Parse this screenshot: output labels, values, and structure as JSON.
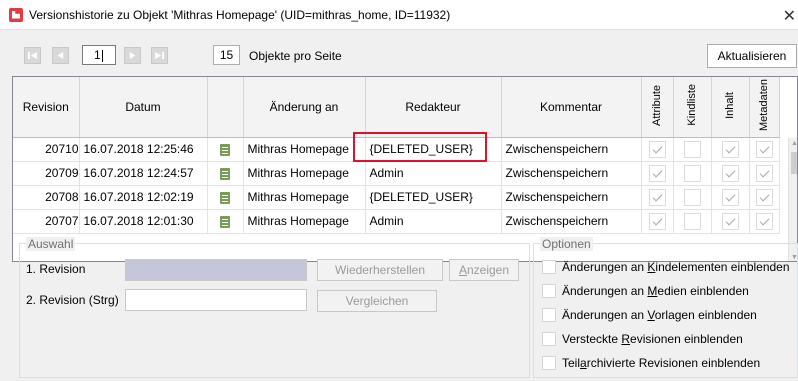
{
  "window": {
    "title": "Versionshistorie zu Objekt 'Mithras Homepage' (UID=mithras_home, ID=11932)",
    "close_glyph": "✕"
  },
  "toolbar": {
    "page_value": "1",
    "per_page_value": "15",
    "per_page_label": "Objekte pro Seite",
    "refresh_label": "Aktualisieren"
  },
  "table": {
    "headers": {
      "revision": "Revision",
      "datum": "Datum",
      "aenderung": "Änderung an",
      "redakteur": "Redakteur",
      "kommentar": "Kommentar",
      "attribute": "Attribute",
      "kindliste": "Kindliste",
      "inhalt": "Inhalt",
      "metadaten": "Metadaten"
    },
    "rows": [
      {
        "revision": "20710",
        "datum": "16.07.2018 12:25:46",
        "aenderung": "Mithras Homepage",
        "redakteur": "{DELETED_USER}",
        "kommentar": "Zwischenspeichern",
        "attribute": true,
        "kindliste": false,
        "inhalt": true,
        "metadaten": true
      },
      {
        "revision": "20709",
        "datum": "16.07.2018 12:24:57",
        "aenderung": "Mithras Homepage",
        "redakteur": "Admin",
        "kommentar": "Zwischenspeichern",
        "attribute": true,
        "kindliste": false,
        "inhalt": true,
        "metadaten": true
      },
      {
        "revision": "20708",
        "datum": "16.07.2018 12:02:19",
        "aenderung": "Mithras Homepage",
        "redakteur": "{DELETED_USER}",
        "kommentar": "Zwischenspeichern",
        "attribute": true,
        "kindliste": false,
        "inhalt": true,
        "metadaten": true
      },
      {
        "revision": "20707",
        "datum": "16.07.2018 12:01:30",
        "aenderung": "Mithras Homepage",
        "redakteur": "Admin",
        "kommentar": "Zwischenspeichern",
        "attribute": true,
        "kindliste": false,
        "inhalt": true,
        "metadaten": true
      }
    ]
  },
  "auswahl": {
    "legend": "Auswahl",
    "rev1_label": "1. Revision",
    "rev2_label": "2. Revision (Strg)",
    "restore_label": "Wiederherstellen",
    "show_label_pre": "",
    "show_label_u": "A",
    "show_label_post": "nzeigen",
    "compare_label": "Vergleichen"
  },
  "optionen": {
    "legend": "Optionen",
    "items": [
      {
        "pre": "Änderungen an ",
        "u": "K",
        "post": "indelementen einblenden"
      },
      {
        "pre": "Änderungen an ",
        "u": "M",
        "post": "edien einblenden"
      },
      {
        "pre": "Änderungen an ",
        "u": "V",
        "post": "orlagen einblenden"
      },
      {
        "pre": "Versteckte ",
        "u": "R",
        "post": "evisionen einblenden"
      },
      {
        "pre": "Teil",
        "u": "a",
        "post": "rchivierte Revisionen einblenden"
      }
    ]
  },
  "colors": {
    "highlight": "#e0102a",
    "app_icon": "#e23b43",
    "doc_icon": "#7a9a5a"
  }
}
